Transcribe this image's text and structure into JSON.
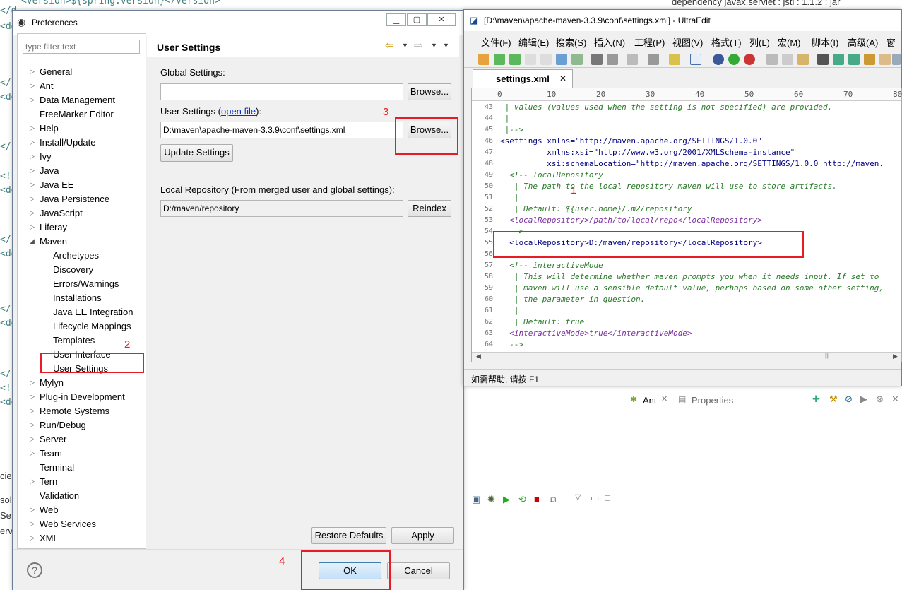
{
  "background": {
    "code_lines": [
      "<version>${spring.version}</version>",
      "</d",
      "<de",
      "</",
      "<de",
      "</",
      "<!-",
      "<de",
      "</",
      "<de",
      "</",
      "<de",
      "</",
      "<!-",
      "<de"
    ],
    "right_top_text": "dependency  javax.servlet : jstl : 1.1.2 : jar",
    "left_tabs": [
      "cies",
      "solo",
      "Se",
      "erve"
    ],
    "ant_tab": "Ant",
    "properties_tab": "Properties"
  },
  "preferences": {
    "title": "Preferences",
    "filter_placeholder": "type filter text",
    "tree": [
      {
        "label": "General",
        "arrow": "▷",
        "level": 0
      },
      {
        "label": "Ant",
        "arrow": "▷",
        "level": 0
      },
      {
        "label": "Data Management",
        "arrow": "▷",
        "level": 0
      },
      {
        "label": "FreeMarker Editor",
        "arrow": "",
        "level": 0
      },
      {
        "label": "Help",
        "arrow": "▷",
        "level": 0
      },
      {
        "label": "Install/Update",
        "arrow": "▷",
        "level": 0
      },
      {
        "label": "Ivy",
        "arrow": "▷",
        "level": 0
      },
      {
        "label": "Java",
        "arrow": "▷",
        "level": 0
      },
      {
        "label": "Java EE",
        "arrow": "▷",
        "level": 0
      },
      {
        "label": "Java Persistence",
        "arrow": "▷",
        "level": 0
      },
      {
        "label": "JavaScript",
        "arrow": "▷",
        "level": 0
      },
      {
        "label": "Liferay",
        "arrow": "▷",
        "level": 0
      },
      {
        "label": "Maven",
        "arrow": "◢",
        "level": 0
      },
      {
        "label": "Archetypes",
        "arrow": "",
        "level": 1
      },
      {
        "label": "Discovery",
        "arrow": "",
        "level": 1
      },
      {
        "label": "Errors/Warnings",
        "arrow": "",
        "level": 1
      },
      {
        "label": "Installations",
        "arrow": "",
        "level": 1
      },
      {
        "label": "Java EE Integration",
        "arrow": "",
        "level": 1
      },
      {
        "label": "Lifecycle Mappings",
        "arrow": "",
        "level": 1
      },
      {
        "label": "Templates",
        "arrow": "",
        "level": 1
      },
      {
        "label": "User Interface",
        "arrow": "",
        "level": 1
      },
      {
        "label": "User Settings",
        "arrow": "",
        "level": 1
      },
      {
        "label": "Mylyn",
        "arrow": "▷",
        "level": 0
      },
      {
        "label": "Plug-in Development",
        "arrow": "▷",
        "level": 0
      },
      {
        "label": "Remote Systems",
        "arrow": "▷",
        "level": 0
      },
      {
        "label": "Run/Debug",
        "arrow": "▷",
        "level": 0
      },
      {
        "label": "Server",
        "arrow": "▷",
        "level": 0
      },
      {
        "label": "Team",
        "arrow": "▷",
        "level": 0
      },
      {
        "label": "Terminal",
        "arrow": "",
        "level": 0
      },
      {
        "label": "Tern",
        "arrow": "▷",
        "level": 0
      },
      {
        "label": "Validation",
        "arrow": "",
        "level": 0
      },
      {
        "label": "Web",
        "arrow": "▷",
        "level": 0
      },
      {
        "label": "Web Services",
        "arrow": "▷",
        "level": 0
      },
      {
        "label": "XML",
        "arrow": "▷",
        "level": 0
      }
    ],
    "page_title": "User Settings",
    "global_settings_label": "Global Settings:",
    "global_settings_value": "",
    "user_settings_label": "User Settings (",
    "open_file_link": "open file",
    "user_settings_label_end": "):",
    "user_settings_value": "D:\\maven\\apache-maven-3.3.9\\conf\\settings.xml",
    "browse_label": "Browse...",
    "update_settings_label": "Update Settings",
    "local_repo_label": "Local Repository (From merged user and global settings):",
    "local_repo_value": "D:/maven/repository",
    "reindex_label": "Reindex",
    "restore_defaults_label": "Restore Defaults",
    "apply_label": "Apply",
    "ok_label": "OK",
    "cancel_label": "Cancel",
    "annotations": [
      "1",
      "2",
      "3",
      "4"
    ]
  },
  "ultraedit": {
    "title": "[D:\\maven\\apache-maven-3.3.9\\conf\\settings.xml] - UltraEdit",
    "menus": [
      "文件(F)",
      "编辑(E)",
      "搜索(S)",
      "插入(N)",
      "工程(P)",
      "视图(V)",
      "格式(T)",
      "列(L)",
      "宏(M)",
      "脚本(I)",
      "高级(A)",
      "窗口"
    ],
    "tab_label": "settings.xml",
    "ruler": [
      "0",
      "10",
      "20",
      "30",
      "40",
      "50",
      "60",
      "70",
      "80"
    ],
    "lines": [
      {
        "n": "43",
        "t": " | values (values used when the setting is not specified) are provided."
      },
      {
        "n": "44",
        "t": " |"
      },
      {
        "n": "45",
        "t": " |-->"
      },
      {
        "n": "46",
        "t": "<settings xmlns=\"http://maven.apache.org/SETTINGS/1.0.0\""
      },
      {
        "n": "47",
        "t": "          xmlns:xsi=\"http://www.w3.org/2001/XMLSchema-instance\""
      },
      {
        "n": "48",
        "t": "          xsi:schemaLocation=\"http://maven.apache.org/SETTINGS/1.0.0 http://maven."
      },
      {
        "n": "49",
        "t": "  <!-- localRepository"
      },
      {
        "n": "50",
        "t": "   | The path to the local repository maven will use to store artifacts."
      },
      {
        "n": "51",
        "t": "   |"
      },
      {
        "n": "52",
        "t": "   | Default: ${user.home}/.m2/repository"
      },
      {
        "n": "53",
        "t": "  <localRepository>/path/to/local/repo</localRepository>"
      },
      {
        "n": "54",
        "t": "  -->"
      },
      {
        "n": "55",
        "t": "  <localRepository>D:/maven/repository</localRepository>"
      },
      {
        "n": "56",
        "t": ""
      },
      {
        "n": "57",
        "t": "  <!-- interactiveMode"
      },
      {
        "n": "58",
        "t": "   | This will determine whether maven prompts you when it needs input. If set to"
      },
      {
        "n": "59",
        "t": "   | maven will use a sensible default value, perhaps based on some other setting,"
      },
      {
        "n": "60",
        "t": "   | the parameter in question."
      },
      {
        "n": "61",
        "t": "   |"
      },
      {
        "n": "62",
        "t": "   | Default: true"
      },
      {
        "n": "63",
        "t": "  <interactiveMode>true</interactiveMode>"
      },
      {
        "n": "64",
        "t": "  -->"
      }
    ],
    "status": "如需帮助, 请按 F1"
  },
  "colors": {
    "annotation": "#e81c24",
    "ok_button": "#cfe6fb"
  }
}
